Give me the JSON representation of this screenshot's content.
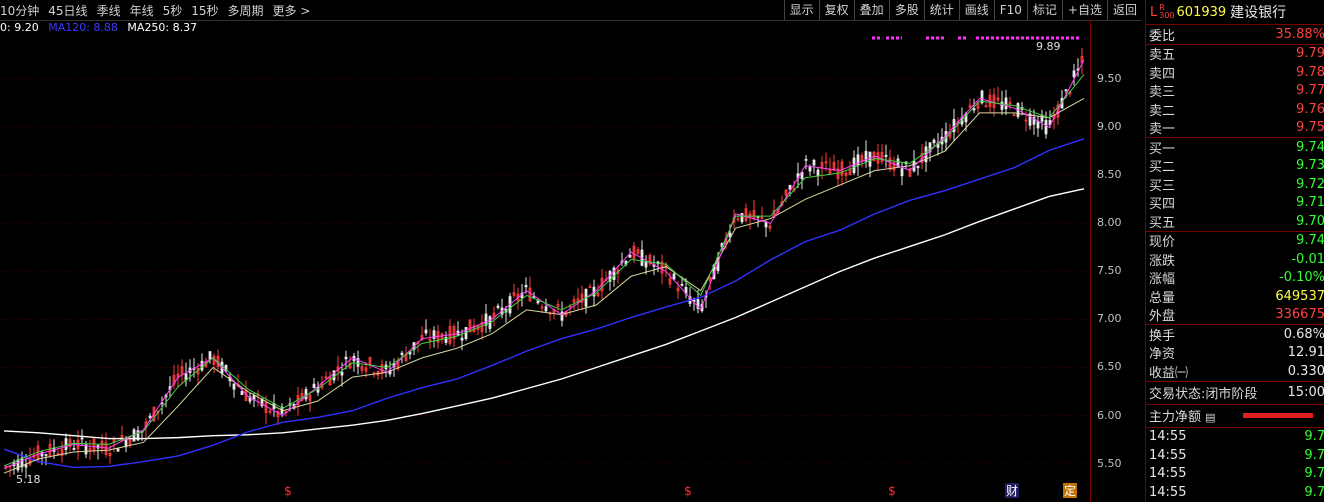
{
  "toolbar": {
    "periods": [
      "10分钟",
      "45日线",
      "季线",
      "年线",
      "5秒",
      "15秒",
      "多周期",
      "更多 >"
    ],
    "buttons": [
      "显示",
      "复权",
      "叠加",
      "多股",
      "统计",
      "画线",
      "F10",
      "标记",
      "+自选",
      "返回"
    ]
  },
  "ma_legend": [
    {
      "label": "0: 9.20",
      "color": "#ffffff"
    },
    {
      "label": "MA120: 8.88",
      "color": "#3a3aff"
    },
    {
      "label": "MA250: 8.37",
      "color": "#ffffff"
    }
  ],
  "price_axis": [
    "9.50",
    "9.00",
    "8.50",
    "8.00",
    "7.50",
    "7.00",
    "6.50",
    "6.00",
    "5.50"
  ],
  "annotations": {
    "high": "9.89",
    "low": "5.18"
  },
  "markers": [
    "$",
    "$",
    "$",
    "财",
    "定"
  ],
  "stock": {
    "flag": "L",
    "tag_top": "R",
    "tag_bottom": "300",
    "code": "601939",
    "name": "建设银行"
  },
  "weibi": {
    "label": "委比",
    "value": "35.88%"
  },
  "asks": [
    {
      "label": "卖五",
      "price": "9.79"
    },
    {
      "label": "卖四",
      "price": "9.78"
    },
    {
      "label": "卖三",
      "price": "9.77"
    },
    {
      "label": "卖二",
      "price": "9.76"
    },
    {
      "label": "卖一",
      "price": "9.75"
    }
  ],
  "bids": [
    {
      "label": "买一",
      "price": "9.74"
    },
    {
      "label": "买二",
      "price": "9.73"
    },
    {
      "label": "买三",
      "price": "9.72"
    },
    {
      "label": "买四",
      "price": "9.71"
    },
    {
      "label": "买五",
      "price": "9.70"
    }
  ],
  "quote": [
    {
      "label": "现价",
      "value": "9.74",
      "cls": "green"
    },
    {
      "label": "涨跌",
      "value": "-0.01",
      "cls": "green"
    },
    {
      "label": "涨幅",
      "value": "-0.10%",
      "cls": "green"
    },
    {
      "label": "总量",
      "value": "649537",
      "cls": "yellow"
    },
    {
      "label": "外盘",
      "value": "336675",
      "cls": "red"
    }
  ],
  "stats": [
    {
      "label": "换手",
      "value": "0.68%"
    },
    {
      "label": "净资",
      "value": "12.91"
    },
    {
      "label": "收益㈠",
      "value": "0.330"
    }
  ],
  "status": {
    "label": "交易状态:",
    "value": "闭市阶段",
    "time": "15:00"
  },
  "main_force": {
    "label": "主力净额"
  },
  "ticks": [
    {
      "time": "14:55",
      "price": "9.7"
    },
    {
      "time": "14:55",
      "price": "9.7"
    },
    {
      "time": "14:55",
      "price": "9.7"
    },
    {
      "time": "14:55",
      "price": "9.7"
    }
  ],
  "chart_data": {
    "type": "line",
    "title": "",
    "ylim": [
      5.1,
      9.95
    ],
    "series": [
      {
        "name": "MA250",
        "values": [
          5.84,
          5.82,
          5.79,
          5.76,
          5.76,
          5.77,
          5.79,
          5.8,
          5.82,
          5.86,
          5.9,
          5.95,
          6.02,
          6.1,
          6.18,
          6.28,
          6.38,
          6.5,
          6.62,
          6.74,
          6.88,
          7.02,
          7.18,
          7.34,
          7.5,
          7.64,
          7.76,
          7.88,
          8.02,
          8.15,
          8.28,
          8.36
        ]
      },
      {
        "name": "MA120",
        "values": [
          5.65,
          5.52,
          5.46,
          5.47,
          5.52,
          5.58,
          5.69,
          5.83,
          5.93,
          5.98,
          6.05,
          6.18,
          6.29,
          6.38,
          6.52,
          6.67,
          6.8,
          6.9,
          7.02,
          7.13,
          7.23,
          7.4,
          7.62,
          7.81,
          7.93,
          8.1,
          8.24,
          8.34,
          8.46,
          8.58,
          8.76,
          8.88
        ]
      },
      {
        "name": "MA20",
        "values": [
          5.4,
          5.55,
          5.62,
          5.64,
          5.72,
          6.1,
          6.5,
          6.25,
          6.05,
          6.15,
          6.4,
          6.45,
          6.6,
          6.7,
          6.85,
          7.1,
          7.05,
          7.15,
          7.45,
          7.55,
          7.3,
          7.95,
          8.05,
          8.25,
          8.4,
          8.55,
          8.6,
          8.75,
          9.15,
          9.15,
          9.1,
          9.3
        ]
      },
      {
        "name": "MA5",
        "values": [
          5.45,
          5.6,
          5.7,
          5.66,
          5.85,
          6.4,
          6.6,
          6.2,
          6.0,
          6.3,
          6.6,
          6.45,
          6.8,
          6.85,
          7.0,
          7.3,
          7.05,
          7.3,
          7.7,
          7.5,
          7.1,
          8.1,
          8.0,
          8.6,
          8.55,
          8.7,
          8.55,
          8.9,
          9.3,
          9.2,
          9.0,
          9.7
        ]
      }
    ]
  }
}
